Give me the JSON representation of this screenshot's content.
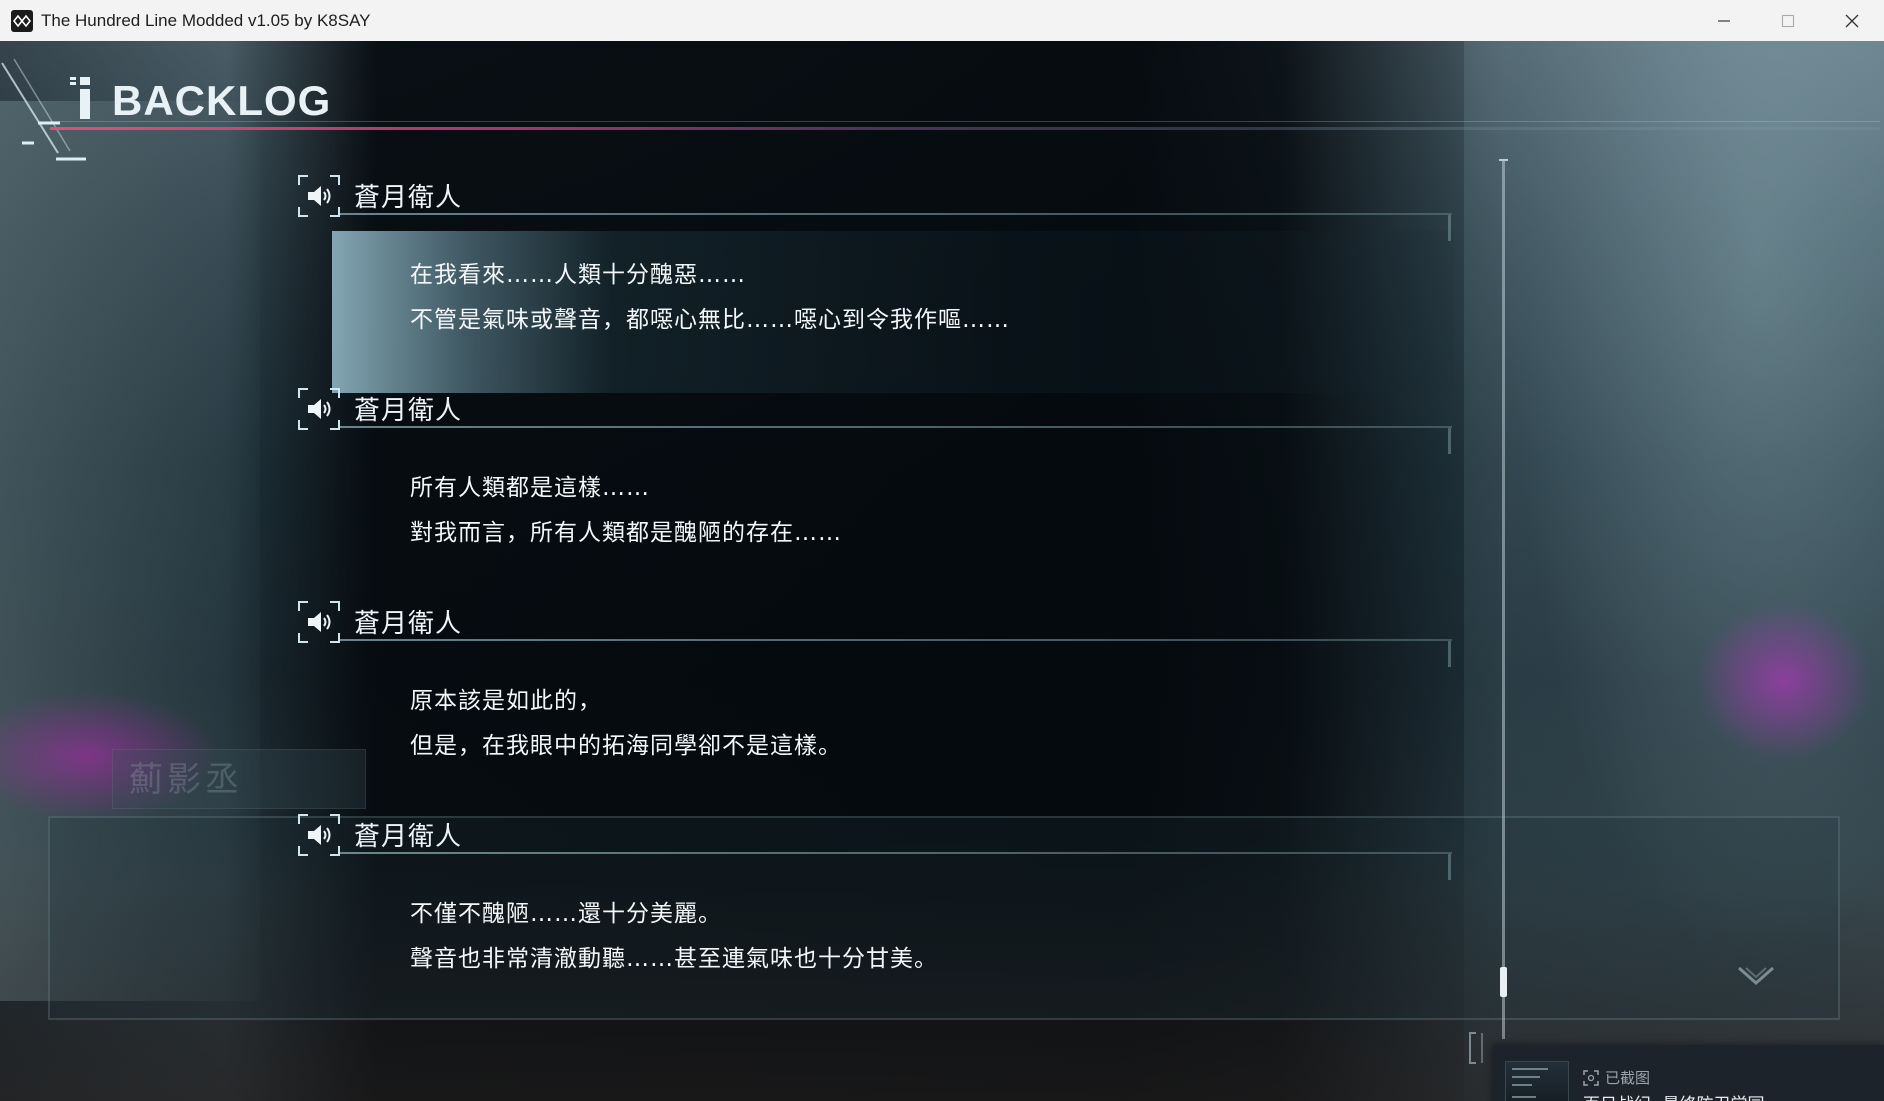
{
  "window": {
    "title": "The Hundred Line Modded v1.05 by K8SAY",
    "controls": [
      "minimize-icon",
      "maximize-icon",
      "close-icon"
    ]
  },
  "backlog": {
    "title": "BACKLOG",
    "entries": [
      {
        "speaker": "蒼月衛人",
        "lines": [
          "在我看來……人類十分醜惡……",
          "不管是氣味或聲音，都噁心無比……噁心到令我作嘔……"
        ],
        "selected": true
      },
      {
        "speaker": "蒼月衛人",
        "lines": [
          "所有人類都是這樣……",
          "對我而言，所有人類都是醜陋的存在……"
        ],
        "selected": false
      },
      {
        "speaker": "蒼月衛人",
        "lines": [
          "原本該是如此的，",
          "但是，在我眼中的拓海同學卻不是這樣。"
        ],
        "selected": false
      },
      {
        "speaker": "蒼月衛人",
        "lines": [
          "不僅不醜陋……還十分美麗。",
          "聲音也非常清澈動聽……甚至連氣味也十分甘美。"
        ],
        "selected": false
      }
    ],
    "scroll_position": 1.0
  },
  "background": {
    "namebox_text": "薊影丞"
  },
  "toast": {
    "caption": "已截图",
    "title": "百日战纪 -最终防卫学园-"
  },
  "colors": {
    "accent_line": "#e65078",
    "text": "#f3f7f9",
    "titlebar_bg": "#f3f3f3"
  }
}
